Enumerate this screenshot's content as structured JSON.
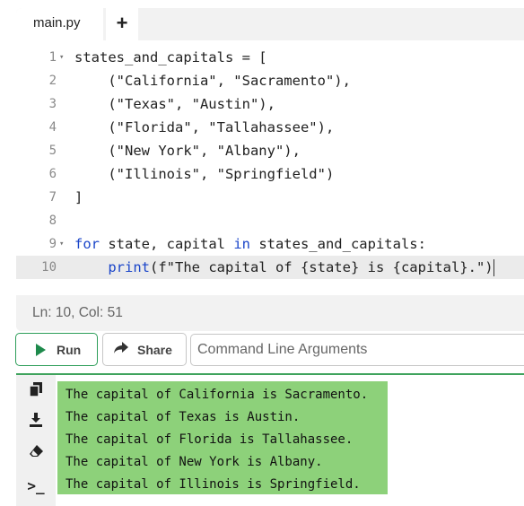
{
  "tabs": {
    "active": "main.py",
    "add_label": "+"
  },
  "editor": {
    "lines": [
      {
        "n": "1",
        "fold": true,
        "parts": [
          {
            "t": "states_and_capitals = [",
            "c": ""
          }
        ]
      },
      {
        "n": "2",
        "fold": false,
        "parts": [
          {
            "t": "    (\"California\", \"Sacramento\"),",
            "c": ""
          }
        ]
      },
      {
        "n": "3",
        "fold": false,
        "parts": [
          {
            "t": "    (\"Texas\", \"Austin\"),",
            "c": ""
          }
        ]
      },
      {
        "n": "4",
        "fold": false,
        "parts": [
          {
            "t": "    (\"Florida\", \"Tallahassee\"),",
            "c": ""
          }
        ]
      },
      {
        "n": "5",
        "fold": false,
        "parts": [
          {
            "t": "    (\"New York\", \"Albany\"),",
            "c": ""
          }
        ]
      },
      {
        "n": "6",
        "fold": false,
        "parts": [
          {
            "t": "    (\"Illinois\", \"Springfield\")",
            "c": ""
          }
        ]
      },
      {
        "n": "7",
        "fold": false,
        "parts": [
          {
            "t": "]",
            "c": ""
          }
        ]
      },
      {
        "n": "8",
        "fold": false,
        "parts": [
          {
            "t": "",
            "c": ""
          }
        ]
      },
      {
        "n": "9",
        "fold": true,
        "parts": [
          {
            "t": "for",
            "c": "kw"
          },
          {
            "t": " state, capital ",
            "c": ""
          },
          {
            "t": "in",
            "c": "kw"
          },
          {
            "t": " states_and_capitals:",
            "c": ""
          }
        ]
      },
      {
        "n": "10",
        "fold": false,
        "active": true,
        "parts": [
          {
            "t": "    ",
            "c": ""
          },
          {
            "t": "print",
            "c": "kw"
          },
          {
            "t": "(f\"The capital of {state} is {capital}.\")",
            "c": ""
          }
        ]
      }
    ],
    "status": "Ln: 10,  Col: 51"
  },
  "toolbar": {
    "run_label": "Run",
    "share_label": "Share",
    "args_placeholder": "Command Line Arguments"
  },
  "output": {
    "side_icons": [
      "copy-icon",
      "download-icon",
      "eraser-icon",
      "terminal-icon"
    ],
    "lines": [
      "The capital of California is Sacramento.",
      "The capital of Texas is Austin.",
      "The capital of Florida is Tallahassee.",
      "The capital of New York is Albany.",
      "The capital of Illinois is Springfield."
    ]
  },
  "colors": {
    "run_accent": "#1e8a4c",
    "keyword": "#1a45c9",
    "output_selection": "#8dd17a",
    "divider": "#3fa35d"
  }
}
